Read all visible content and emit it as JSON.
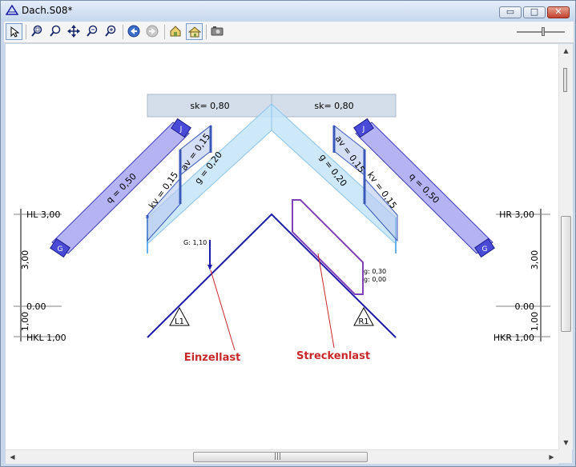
{
  "window": {
    "title": "Dach.S08*",
    "minimize_glyph": "▭",
    "maximize_glyph": "□",
    "close_glyph": "✕"
  },
  "toolbar": {
    "tools": [
      "select-arrow-icon",
      "zoom-window-icon",
      "zoom-in-icon",
      "pan-icon",
      "zoom-previous-icon",
      "zoom-all-icon",
      "back-icon",
      "forward-icon",
      "view-3d-icon",
      "home-view-icon",
      "screenshot-icon"
    ]
  },
  "drawing": {
    "sk_left": "sk= 0,80",
    "sk_right": "sk= 0,80",
    "q_left": "q = 0,50",
    "q_right": "q = 0,50",
    "kv_left": "kv = 0,15",
    "av_left": "av = 0,15",
    "av_right": "av = 0,15",
    "kv_right": "kv = 0,15",
    "g_left": "g = 0,20",
    "g_right": "g = 0,20",
    "purlin_top_left": "J",
    "purlin_bottom_left": "G",
    "purlin_top_right": "J",
    "purlin_bottom_right": "G",
    "point_load": "G: 1,10",
    "line_load_1": "g: 0,30",
    "line_load_2": "g: 0,00",
    "support_left": "L1",
    "support_right": "R1",
    "label_point_load": "Einzellast",
    "label_line_load": "Streckenlast",
    "hl": "HL 3,00",
    "hr": "HR 3,00",
    "hkl": "HKL 1,00",
    "hkr": "HKR 1,00",
    "zero_left": "0.00",
    "zero_right": "0.00",
    "dim_300_left": "3,00",
    "dim_300_right": "3,00",
    "dim_100_left": "1,00",
    "dim_100_right": "1,00"
  },
  "colors": {
    "structure": "#1c1ca8",
    "bracket": "#3a5ab8",
    "callout": "#c8282a",
    "q_fill": "#b4b4f4",
    "g_fill": "#c4e4f8",
    "sk_fill": "#d4deea",
    "line_load": "#8040b8"
  },
  "scroll": {
    "down_arrow": "▼",
    "up_arrow": "▲",
    "left_arrow": "◀",
    "right_arrow": "▶",
    "grip": "|||"
  }
}
